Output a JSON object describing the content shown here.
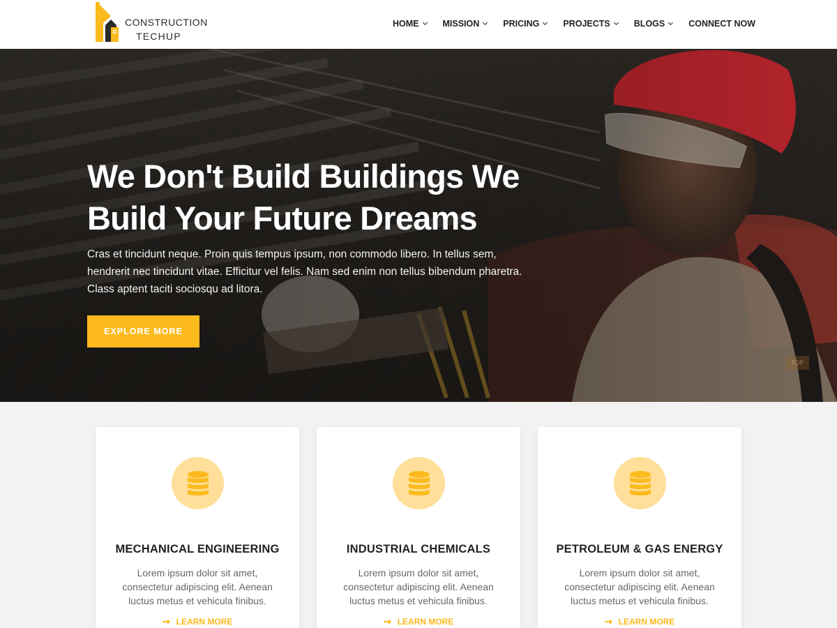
{
  "brand": {
    "line1": "CONSTRUCTION",
    "line2": "TECHUP"
  },
  "nav": {
    "items": [
      {
        "label": "HOME",
        "dropdown": true
      },
      {
        "label": "MISSION",
        "dropdown": true
      },
      {
        "label": "PRICING",
        "dropdown": true
      },
      {
        "label": "PROJECTS",
        "dropdown": true
      },
      {
        "label": "BLOGS",
        "dropdown": true
      },
      {
        "label": "CONNECT NOW",
        "dropdown": false
      }
    ]
  },
  "hero": {
    "title_lines": [
      "We Don't Build Buildings We",
      "Build Your Future Dreams"
    ],
    "description_lines": [
      "Cras et tincidunt neque. Proin quis tempus ipsum, non commodo libero. In tellus sem,",
      "hendrerit nec tincidunt vitae. Efficitur vel felis. Nam sed enim non tellus bibendum pharetra.",
      "Class aptent taciti sociosqu ad litora."
    ],
    "button_label": "EXPLORE MORE",
    "top_button_label": "TOP"
  },
  "services": [
    {
      "icon": "coins-stack-icon",
      "title": "MECHANICAL ENGINEERING",
      "text_lines": [
        "Lorem ipsum dolor sit amet,",
        "consectetur adipiscing elit. Aenean",
        "luctus metus et vehicula finibus."
      ],
      "link_label": "LEARN MORE"
    },
    {
      "icon": "coins-stack-icon",
      "title": "INDUSTRIAL CHEMICALS",
      "text_lines": [
        "Lorem ipsum dolor sit amet,",
        "consectetur adipiscing elit. Aenean",
        "luctus metus et vehicula finibus."
      ],
      "link_label": "LEARN MORE"
    },
    {
      "icon": "coins-stack-icon",
      "title": "PETROLEUM & GAS ENERGY",
      "text_lines": [
        "Lorem ipsum dolor sit amet,",
        "consectetur adipiscing elit. Aenean",
        "luctus metus et vehicula finibus."
      ],
      "link_label": "LEARN MORE"
    }
  ],
  "colors": {
    "accent": "#fcba1d",
    "icon_circle": "#ffdf99",
    "header_bg": "#ffffff",
    "section_bg": "#f2f2f2",
    "heading": "#222222",
    "body_text": "#666666"
  }
}
